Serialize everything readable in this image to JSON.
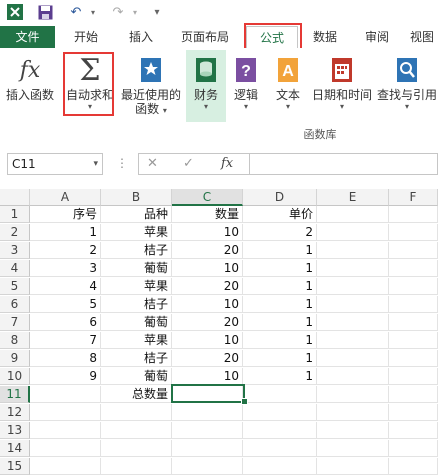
{
  "colors": {
    "accent": "#217346",
    "highlight_box": "#e53935",
    "finance_bg": "#d7efe1"
  },
  "quick_access": {
    "app_icon": "excel-app-icon",
    "save_icon": "save-icon",
    "undo_icon": "undo-icon",
    "redo_icon": "redo-icon"
  },
  "tabs": [
    {
      "label": "文件"
    },
    {
      "label": "开始"
    },
    {
      "label": "插入"
    },
    {
      "label": "页面布局"
    },
    {
      "label": "公式"
    },
    {
      "label": "数据"
    },
    {
      "label": "审阅"
    },
    {
      "label": "视图"
    }
  ],
  "ribbon": {
    "buttons": [
      {
        "label": "插入函数",
        "icon": "fx-icon"
      },
      {
        "label": "自动求和",
        "icon": "sigma-icon"
      },
      {
        "label": "最近使用的",
        "label2": "函数",
        "icon": "star-book-icon"
      },
      {
        "label": "财务",
        "icon": "finance-icon"
      },
      {
        "label": "逻辑",
        "icon": "question-icon"
      },
      {
        "label": "文本",
        "icon": "text-a-icon"
      },
      {
        "label": "日期和时间",
        "icon": "calendar-icon"
      },
      {
        "label": "查找与引用",
        "icon": "magnifier-icon"
      }
    ],
    "group_label": "函数库"
  },
  "formula_bar": {
    "name_box": "C11",
    "fx": "fx",
    "cancel": "✕",
    "confirm": "✓",
    "value": ""
  },
  "grid": {
    "columns": [
      "A",
      "B",
      "C",
      "D",
      "E",
      "F"
    ],
    "selected_column": "C",
    "selected_row": "11",
    "rows": [
      {
        "num": "1",
        "a": "序号",
        "b": "品种",
        "c": "数量",
        "d": "单价"
      },
      {
        "num": "2",
        "a": "1",
        "b": "苹果",
        "c": "10",
        "d": "2"
      },
      {
        "num": "3",
        "a": "2",
        "b": "桔子",
        "c": "20",
        "d": "1"
      },
      {
        "num": "4",
        "a": "3",
        "b": "葡萄",
        "c": "10",
        "d": "1"
      },
      {
        "num": "5",
        "a": "4",
        "b": "苹果",
        "c": "20",
        "d": "1"
      },
      {
        "num": "6",
        "a": "5",
        "b": "桔子",
        "c": "10",
        "d": "1"
      },
      {
        "num": "7",
        "a": "6",
        "b": "葡萄",
        "c": "20",
        "d": "1"
      },
      {
        "num": "8",
        "a": "7",
        "b": "苹果",
        "c": "10",
        "d": "1"
      },
      {
        "num": "9",
        "a": "8",
        "b": "桔子",
        "c": "20",
        "d": "1"
      },
      {
        "num": "10",
        "a": "9",
        "b": "葡萄",
        "c": "10",
        "d": "1"
      },
      {
        "num": "11",
        "a": "",
        "b": "总数量",
        "c": "",
        "d": ""
      },
      {
        "num": "12",
        "a": "",
        "b": "",
        "c": "",
        "d": ""
      },
      {
        "num": "13",
        "a": "",
        "b": "",
        "c": "",
        "d": ""
      },
      {
        "num": "14",
        "a": "",
        "b": "",
        "c": "",
        "d": ""
      },
      {
        "num": "15",
        "a": "",
        "b": "",
        "c": "",
        "d": ""
      }
    ]
  }
}
